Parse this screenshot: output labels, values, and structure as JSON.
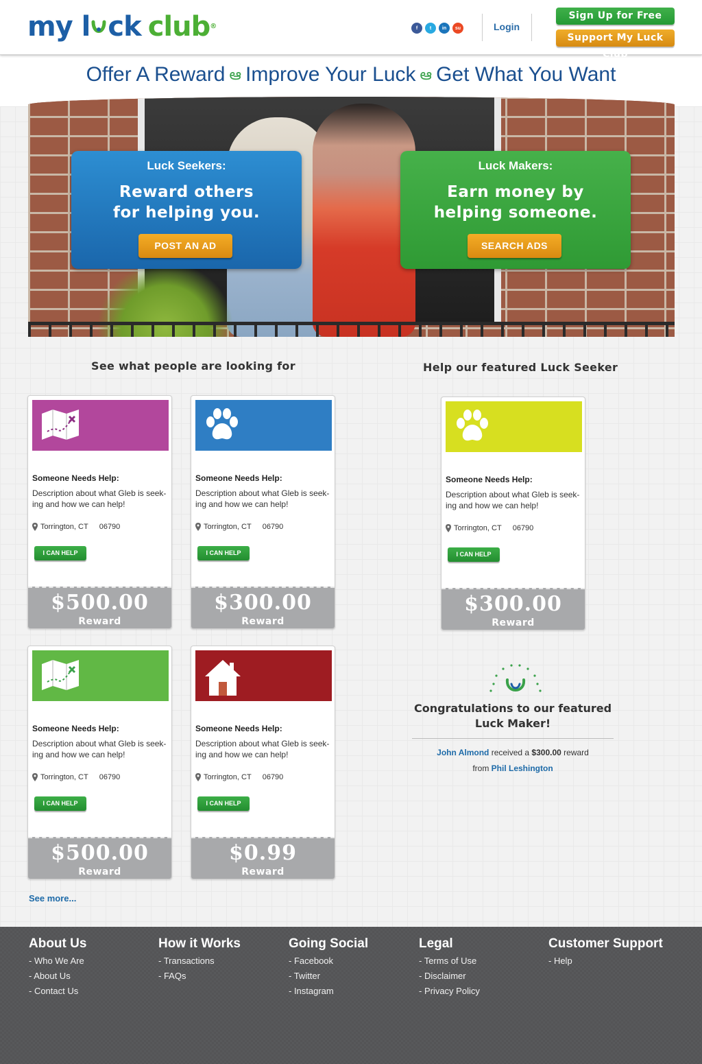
{
  "header": {
    "logo_part_a": "my l",
    "logo_part_b": "ck",
    "logo_part_c": "club",
    "social": [
      {
        "name": "facebook",
        "glyph": "f",
        "color": "#3b5998"
      },
      {
        "name": "twitter",
        "glyph": "t",
        "color": "#29a9e1"
      },
      {
        "name": "linkedin",
        "glyph": "in",
        "color": "#1b75bb"
      },
      {
        "name": "stumbleupon",
        "glyph": "su",
        "color": "#eb4924"
      }
    ],
    "login": "Login",
    "signup": "Sign Up for Free",
    "support": "Support My Luck Club"
  },
  "tagline": {
    "part1": "Offer A Reward",
    "part2": "Improve Your Luck",
    "part3": "Get What You Want"
  },
  "hero": {
    "seekers": {
      "title": "Luck Seekers:",
      "line1": "Reward others",
      "line2": "for helping you.",
      "button": "POST AN AD"
    },
    "makers": {
      "title": "Luck Makers:",
      "line1": "Earn money by",
      "line2": "helping someone.",
      "button": "SEARCH ADS"
    }
  },
  "sections": {
    "looking_for": "See what people are looking for",
    "featured_seeker": "Help our featured Luck Seeker"
  },
  "ads": [
    {
      "icon": "map-icon",
      "color": "#b2479c",
      "heading": "Someone Needs Help:",
      "desc_line1": "Description about what Gleb is seek-",
      "desc_line2": "ing and how we can help!",
      "city": "Torrington, CT",
      "zip": "06790",
      "button": "I CAN HELP",
      "amount": "$500.00",
      "reward_label": "Reward"
    },
    {
      "icon": "paw-icon",
      "color": "#2f7ec4",
      "heading": "Someone Needs Help:",
      "desc_line1": "Description about what Gleb is seek-",
      "desc_line2": "ing and how we can help!",
      "city": "Torrington, CT",
      "zip": "06790",
      "button": "I CAN HELP",
      "amount": "$300.00",
      "reward_label": "Reward"
    },
    {
      "icon": "map-icon",
      "color": "#61b845",
      "heading": "Someone Needs Help:",
      "desc_line1": "Description about what Gleb is seek-",
      "desc_line2": "ing and how we can help!",
      "city": "Torrington, CT",
      "zip": "06790",
      "button": "I CAN HELP",
      "amount": "$500.00",
      "reward_label": "Reward"
    },
    {
      "icon": "house-icon",
      "color": "#9e1c22",
      "heading": "Someone Needs Help:",
      "desc_line1": "Description about what Gleb is seek-",
      "desc_line2": "ing and how we can help!",
      "city": "Torrington, CT",
      "zip": "06790",
      "button": "I CAN HELP",
      "amount": "$0.99",
      "reward_label": "Reward"
    }
  ],
  "featured_ad": {
    "icon": "paw-icon",
    "color": "#d7df20",
    "heading": "Someone Needs Help:",
    "desc_line1": "Description about what Gleb is seek-",
    "desc_line2": "ing and how we can help!",
    "city": "Torrington, CT",
    "zip": "06790",
    "button": "I CAN HELP",
    "amount": "$300.00",
    "reward_label": "Reward"
  },
  "see_more": "See more...",
  "luck_maker": {
    "title_line1": "Congratulations to our featured",
    "title_line2": "Luck Maker!",
    "recipient": "John Almond",
    "received": "received a",
    "amount": "$300.00",
    "reward_word": "reward",
    "from": "from",
    "giver": "Phil Leshington"
  },
  "footer": {
    "columns": [
      {
        "head": "About Us",
        "items": [
          "- Who We Are",
          "- About Us",
          "- Contact Us"
        ]
      },
      {
        "head": "How it Works",
        "items": [
          "- Transactions",
          "- FAQs"
        ]
      },
      {
        "head": "Going Social",
        "items": [
          "- Facebook",
          "- Twitter",
          "- Instagram"
        ]
      },
      {
        "head": "Legal",
        "items": [
          "- Terms of Use",
          "- Disclaimer",
          "- Privacy Policy"
        ]
      },
      {
        "head": "Customer Support",
        "items": [
          "- Help"
        ]
      }
    ]
  }
}
